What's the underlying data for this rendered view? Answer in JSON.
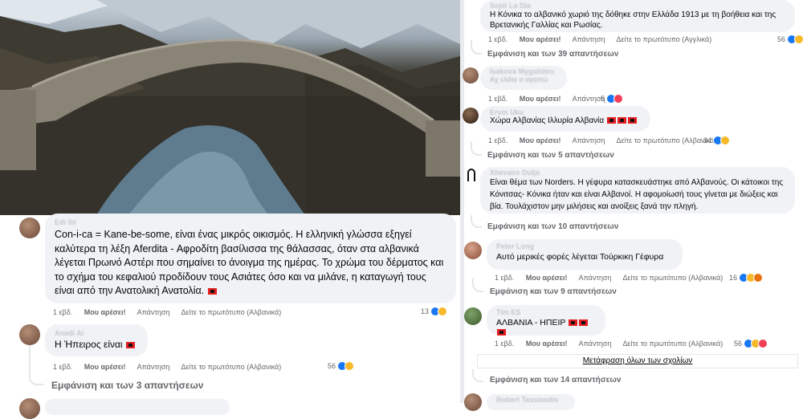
{
  "left": {
    "c1": {
      "author": "Edi Ibi",
      "text": "Con-i-ca = Kane-be-some, είναι ένας μικρός οικισμός. Η ελληνική γλώσσα εξηγεί καλύτερα τη λέξη Aferdita - Αφροδίτη βασίλισσα της θάλασσας, όταν στα αλβανικά λέγεται Πρωινό Αστέρι που σημαίνει το άνοιγμα της ημέρας. Το χρώμα του δέρματος και το σχήμα του κεφαλιού προδίδουν τους Ασιάτες όσο και να μιλάνε, η καταγωγή τους είναι από την Ανατολική Ανατολία.",
      "time": "1 εβδ.",
      "like": "Μου αρέσει!",
      "reply": "Απάντηση",
      "original": "Δείτε το πρωτότυπο (Αλβανικά)",
      "count": "13"
    },
    "c2": {
      "author": "Anadi Ai",
      "text": "Η Ήπειρος είναι",
      "time": "1 εβδ.",
      "like": "Μου αρέσει!",
      "reply": "Απάντηση",
      "original": "Δείτε το πρωτότυπο (Αλβανικά)",
      "count": "56"
    },
    "more": "Εμφάνιση και των 3 απαντήσεων"
  },
  "right": {
    "c1": {
      "author": "Sejdi La Dia",
      "text": "Η Κόνικα το αλβανικό χωριό της δόθηκε στην Ελλάδα 1913 με τη βοήθεια και της Βρετανικής Γαλλίας και Ρωσίας.",
      "time": "1 εβδ.",
      "like": "Μου αρέσει!",
      "reply": "Απάντηση",
      "original": "Δείτε το πρωτότυπο (Αγγλικά)",
      "count": "56"
    },
    "more1": "Εμφάνιση και των 39 απαντήσεων",
    "c2": {
      "author": "Isakova Mygalidou",
      "text": "Αχ ελάτε ο αγαπώ",
      "time": "1 εβδ.",
      "like": "Μου αρέσει!",
      "reply": "Απάντηση",
      "count": "5"
    },
    "c3": {
      "author": "Ervin Uku",
      "text": "Χώρα Αλβανίας Ιλλυρία Αλβανία",
      "time": "1 εβδ.",
      "like": "Μου αρέσει!",
      "reply": "Απάντηση",
      "original": "Δείτε το πρωτότυπο (Αλβανικά)",
      "count": "34"
    },
    "more2": "Εμφάνιση και των 5 απαντήσεων",
    "c4": {
      "author": "Xhevaire Dulja",
      "text": "Είναι θέμα των Norders. Η γέφυρα κατασκευάστηκε από Αλβανούς. Οι κάτοικοι της Κόνιτσας- Κόνικα ήταν και είναι Αλβανοί. Η αφομοίωσή τους γίνεται με διώξεις και βία. Τουλάχιστον μην μιλήσεις και ανοίξεις ξανά την πληγή."
    },
    "more3": "Εμφάνιση και των 10 απαντήσεων",
    "c5": {
      "author": "Peter Long",
      "text": "Αυτό μερικές φορές λέγεται Τούρκικη Γέφυρα",
      "time": "1 εβδ.",
      "like": "Μου αρέσει!",
      "reply": "Απάντηση",
      "original": "Δείτε το πρωτότυπο (Αλβανικά)",
      "count": "16"
    },
    "more4": "Εμφάνιση και των 9 απαντήσεων",
    "c6": {
      "author": "Tim ES",
      "text": "ΑΛΒΑΝΙΑ - ΗΠΕΙΡ",
      "time": "1 εβδ.",
      "like": "Μου αρέσει!",
      "reply": "Απάντηση",
      "original": "Δείτε το πρωτότυπο (Αλβανικά)",
      "count": "56"
    },
    "translate_all": "Μετάφραση όλων των σχολίων",
    "more5": "Εμφάνιση και των 14 απαντήσεων",
    "c7": {
      "author": "Robert Tassiandis"
    }
  }
}
